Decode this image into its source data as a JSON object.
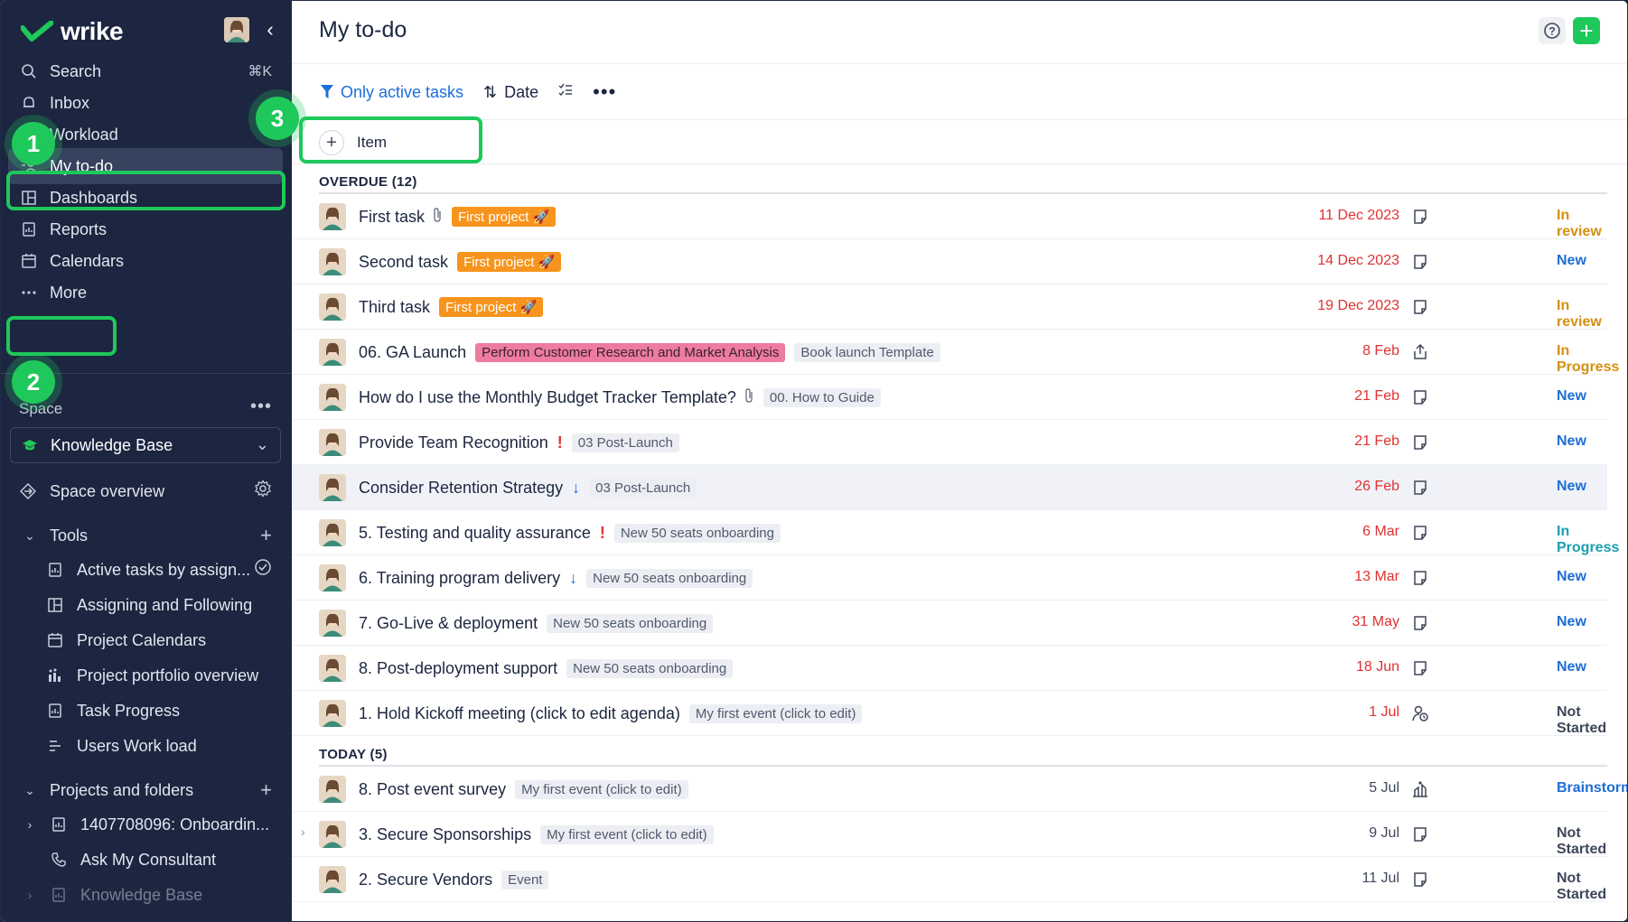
{
  "app": {
    "logo_text": "wrike",
    "collapse_glyph": "‹",
    "accent": "#1ec85a",
    "sidebar_bg": "#1c2640"
  },
  "nav": {
    "items": [
      {
        "label": "Search",
        "icon": "search-icon",
        "shortcut": "⌘K"
      },
      {
        "label": "Inbox",
        "icon": "bell-icon"
      },
      {
        "label": "Workload",
        "icon": "workload-icon"
      },
      {
        "label": "My to-do",
        "icon": "my-todo-icon",
        "active": true
      },
      {
        "label": "Dashboards",
        "icon": "dashboard-icon"
      },
      {
        "label": "Reports",
        "icon": "reports-icon"
      },
      {
        "label": "Calendars",
        "icon": "calendar-icon"
      },
      {
        "label": "More",
        "icon": "more-icon"
      }
    ]
  },
  "steps": [
    "1",
    "2",
    "3"
  ],
  "space": {
    "label": "Space",
    "dots": "•••",
    "selected": "Knowledge Base",
    "overview": "Space overview",
    "tools_label": "Tools",
    "tools": [
      {
        "label": "Active tasks by assign...",
        "icon": "report-icon"
      },
      {
        "label": "Assigning and Following",
        "icon": "dashboard-icon"
      },
      {
        "label": "Project Calendars",
        "icon": "calendar-icon"
      },
      {
        "label": "Project portfolio overview",
        "icon": "portfolio-icon"
      },
      {
        "label": "Task Progress",
        "icon": "report-icon"
      },
      {
        "label": "Users Work load",
        "icon": "workload-icon"
      }
    ],
    "projects_label": "Projects and folders",
    "projects": [
      {
        "label": "1407708096: Onboardin...",
        "icon": "report-icon"
      },
      {
        "label": "Ask My Consultant",
        "icon": "phone-icon"
      },
      {
        "label": "Knowledge Base",
        "icon": "report-icon"
      }
    ]
  },
  "main": {
    "title": "My to-do",
    "filter_label": "Only active tasks",
    "sort_label": "Date",
    "add_item_label": "Item",
    "groups": [
      {
        "title": "OVERDUE (12)",
        "tasks": [
          {
            "title": "First task",
            "attach": true,
            "tags": [
              {
                "text": "First project 🚀",
                "style": "orange"
              }
            ],
            "date": "11 Dec 2023",
            "overdue": true,
            "type": "task-icon",
            "status": "In review",
            "status_color": "#d4900e"
          },
          {
            "title": "Second task",
            "tags": [
              {
                "text": "First project 🚀",
                "style": "orange"
              }
            ],
            "date": "14 Dec 2023",
            "overdue": true,
            "type": "task-icon",
            "status": "New",
            "status_color": "#1d6ed8"
          },
          {
            "title": "Third task",
            "tags": [
              {
                "text": "First project 🚀",
                "style": "orange"
              }
            ],
            "date": "19 Dec 2023",
            "overdue": true,
            "type": "task-icon",
            "status": "In review",
            "status_color": "#d4900e"
          },
          {
            "title": "06. GA Launch",
            "tags": [
              {
                "text": "Perform Customer Research and Market Analysis",
                "style": "pink"
              },
              {
                "text": "Book launch Template",
                "style": "grey"
              }
            ],
            "date": "8 Feb",
            "overdue": true,
            "type": "launch-icon",
            "status": "In Progress",
            "status_color": "#d4900e"
          },
          {
            "title": "How do I use the Monthly Budget Tracker Template?",
            "attach": true,
            "tags": [
              {
                "text": "00. How to Guide",
                "style": "grey"
              }
            ],
            "date": "21 Feb",
            "overdue": true,
            "type": "task-icon",
            "status": "New",
            "status_color": "#1d6ed8"
          },
          {
            "title": "Provide Team Recognition",
            "priority": "!",
            "priority_kind": "high",
            "tags": [
              {
                "text": "03 Post-Launch",
                "style": "grey"
              }
            ],
            "date": "21 Feb",
            "overdue": true,
            "type": "task-icon",
            "status": "New",
            "status_color": "#1d6ed8"
          },
          {
            "title": "Consider Retention Strategy",
            "priority": "↓",
            "priority_kind": "low",
            "tags": [
              {
                "text": "03 Post-Launch",
                "style": "grey"
              }
            ],
            "date": "26 Feb",
            "overdue": true,
            "type": "task-icon",
            "status": "New",
            "status_color": "#1d6ed8",
            "hovered": true
          },
          {
            "title": "5. Testing and quality assurance",
            "priority": "!",
            "priority_kind": "high",
            "tags": [
              {
                "text": "New 50 seats onboarding",
                "style": "grey"
              }
            ],
            "date": "6 Mar",
            "overdue": true,
            "type": "task-icon",
            "status": "In Progress",
            "status_color": "#1a9fb0"
          },
          {
            "title": "6. Training program delivery",
            "priority": "↓",
            "priority_kind": "low",
            "tags": [
              {
                "text": "New 50 seats onboarding",
                "style": "grey"
              }
            ],
            "date": "13 Mar",
            "overdue": true,
            "type": "task-icon",
            "status": "New",
            "status_color": "#1d6ed8"
          },
          {
            "title": "7. Go-Live & deployment",
            "tags": [
              {
                "text": "New 50 seats onboarding",
                "style": "grey"
              }
            ],
            "date": "31 May",
            "overdue": true,
            "type": "task-icon",
            "status": "New",
            "status_color": "#1d6ed8"
          },
          {
            "title": "8. Post-deployment support",
            "tags": [
              {
                "text": "New 50 seats onboarding",
                "style": "grey"
              }
            ],
            "date": "18 Jun",
            "overdue": true,
            "type": "task-icon",
            "status": "New",
            "status_color": "#1d6ed8"
          },
          {
            "title": "1. Hold Kickoff meeting (click to edit agenda)",
            "tags": [
              {
                "text": "My first event (click to edit)",
                "style": "grey"
              }
            ],
            "date": "1 Jul",
            "overdue": true,
            "type": "meeting-icon",
            "status": "Not Started",
            "status_color": "#3e4759"
          }
        ]
      },
      {
        "title": "TODAY (5)",
        "tasks": [
          {
            "title": "8. Post event survey",
            "tags": [
              {
                "text": "My first event (click to edit)",
                "style": "grey"
              }
            ],
            "date": "5 Jul",
            "overdue": false,
            "type": "brainstorm-icon",
            "status": "Brainstorm/Ideating",
            "status_color": "#1d6ed8"
          },
          {
            "title": "3. Secure Sponsorships",
            "expandable": true,
            "tags": [
              {
                "text": "My first event (click to edit)",
                "style": "grey"
              }
            ],
            "date": "9 Jul",
            "overdue": false,
            "type": "task-icon",
            "status": "Not Started",
            "status_color": "#3e4759"
          },
          {
            "title": "2. Secure Vendors",
            "tags": [
              {
                "text": "Event",
                "style": "grey"
              }
            ],
            "date": "11 Jul",
            "overdue": false,
            "type": "task-icon",
            "status": "Not Started",
            "status_color": "#3e4759"
          }
        ]
      }
    ]
  }
}
